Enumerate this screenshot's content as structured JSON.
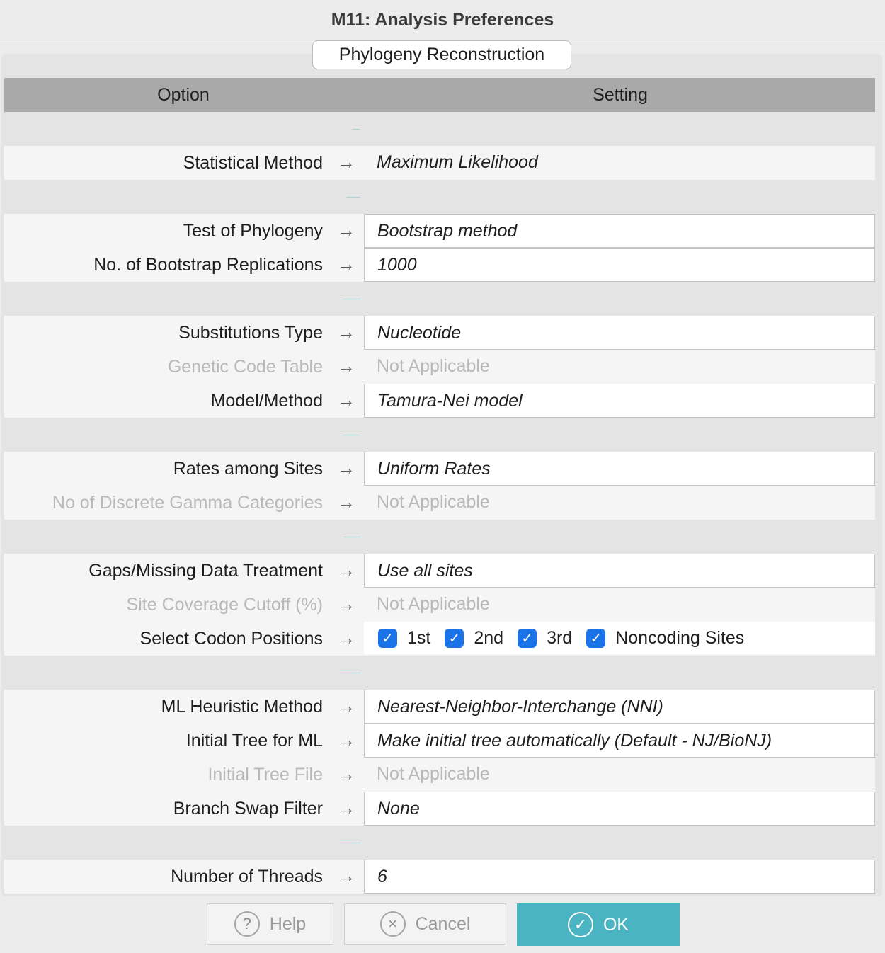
{
  "window": {
    "title": "M11: Analysis Preferences"
  },
  "tab": {
    "label": "Phylogeny Reconstruction"
  },
  "header": {
    "option": "Option",
    "setting": "Setting"
  },
  "rows": {
    "statistical_method": {
      "label": "Statistical Method",
      "value": "Maximum Likelihood"
    },
    "test_of_phylogeny": {
      "label": "Test of Phylogeny",
      "value": "Bootstrap method"
    },
    "bootstrap_reps": {
      "label": "No. of Bootstrap Replications",
      "value": "1000"
    },
    "substitutions_type": {
      "label": "Substitutions Type",
      "value": "Nucleotide"
    },
    "genetic_code_table": {
      "label": "Genetic Code Table",
      "value": "Not Applicable"
    },
    "model_method": {
      "label": "Model/Method",
      "value": "Tamura-Nei model"
    },
    "rates_among_sites": {
      "label": "Rates among Sites",
      "value": "Uniform Rates"
    },
    "gamma_categories": {
      "label": "No of Discrete Gamma Categories",
      "value": "Not Applicable"
    },
    "gaps_treatment": {
      "label": "Gaps/Missing Data Treatment",
      "value": "Use all sites"
    },
    "site_coverage": {
      "label": "Site Coverage Cutoff (%)",
      "value": "Not Applicable"
    },
    "codon_positions": {
      "label": "Select Codon Positions",
      "options": [
        {
          "label": "1st",
          "checked": true
        },
        {
          "label": "2nd",
          "checked": true
        },
        {
          "label": "3rd",
          "checked": true
        },
        {
          "label": "Noncoding Sites",
          "checked": true
        }
      ]
    },
    "ml_heuristic": {
      "label": "ML Heuristic Method",
      "value": "Nearest-Neighbor-Interchange (NNI)"
    },
    "initial_tree": {
      "label": "Initial Tree for ML",
      "value": "Make initial tree automatically (Default - NJ/BioNJ)"
    },
    "initial_tree_file": {
      "label": "Initial Tree File",
      "value": "Not Applicable"
    },
    "branch_swap": {
      "label": "Branch Swap Filter",
      "value": "None"
    },
    "threads": {
      "label": "Number of Threads",
      "value": "6"
    }
  },
  "arrow_glyph": "→",
  "buttons": {
    "help": {
      "label": "Help",
      "icon": "?"
    },
    "cancel": {
      "label": "Cancel",
      "icon": "×"
    },
    "ok": {
      "label": "OK",
      "icon": "✓"
    }
  },
  "colors": {
    "ok_button": "#4ab4c2",
    "checkbox": "#1a73e8",
    "header_bg": "#a9a9a9"
  }
}
